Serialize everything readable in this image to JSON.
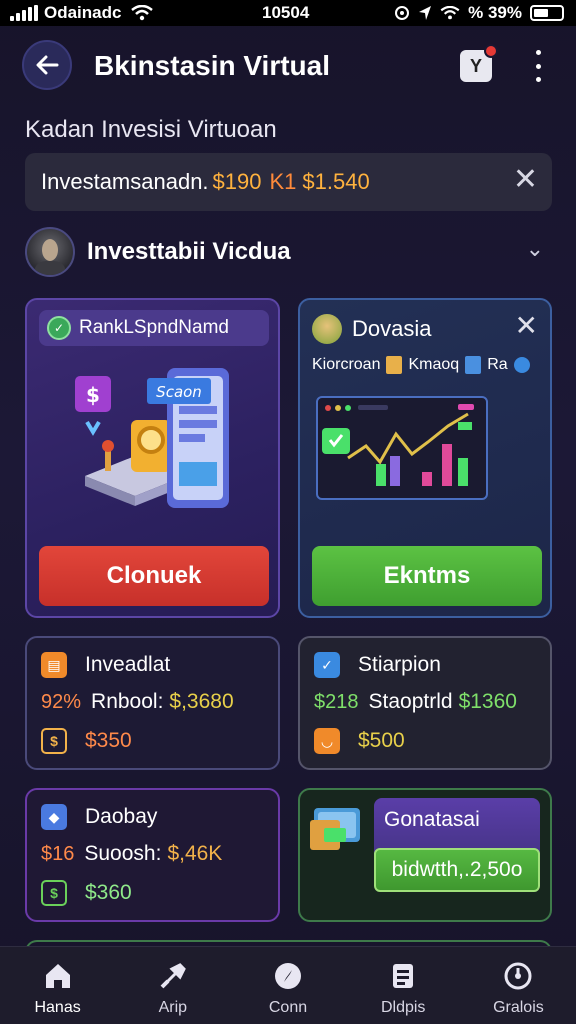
{
  "status_bar": {
    "carrier": "Odainadc",
    "time": "10504",
    "battery": "% 39%"
  },
  "header": {
    "title": "Bkinstasin Virtual",
    "notif_badge": "Y"
  },
  "subtitle": "Kadan Invesisi Virtuoan",
  "invest_bar": {
    "label": "Investamsanadn.",
    "amount1": "$190",
    "separator": "K1",
    "amount2": "$1.540"
  },
  "section": {
    "title": "Investtabii Vicdua"
  },
  "card_left": {
    "pill_label": "RankLSpndNamd",
    "illus_text": "Scaon",
    "button_label": "Clonuek"
  },
  "card_right": {
    "title": "Dovasia",
    "tag1": "Kiorcroan",
    "tag2": "Kmaoq",
    "tag3": "Ra",
    "button_label": "Ekntms"
  },
  "small_cards": [
    {
      "title": "Inveadlat",
      "row2_pct": "92%",
      "row2_label": "Rnbool:",
      "row2_value": "$,3680",
      "row3_value": "$350"
    },
    {
      "title": "Stiarpion",
      "row2_pct": "$218",
      "row2_label": "Staoptrld",
      "row2_value": "$1360",
      "row3_value": "$500"
    },
    {
      "title": "Daobay",
      "row2_pct": "$16",
      "row2_label": "Suoosh:",
      "row2_value": "$,46K",
      "row3_value": "$360"
    },
    {
      "title": "Gonatasai",
      "button_label": "bidwtth,.2,50o"
    }
  ],
  "bottom_nav": [
    {
      "label": "Hanas",
      "icon": "home-icon"
    },
    {
      "label": "Arip",
      "icon": "tools-icon"
    },
    {
      "label": "Conn",
      "icon": "compass-icon"
    },
    {
      "label": "Dldpis",
      "icon": "document-icon"
    },
    {
      "label": "Gralois",
      "icon": "gauge-icon"
    }
  ],
  "colors": {
    "accent_gold": "#f2b24a",
    "accent_green": "#7fe06a",
    "button_red": "#d63a30",
    "button_green": "#4fb03a",
    "background": "#1a1630"
  }
}
